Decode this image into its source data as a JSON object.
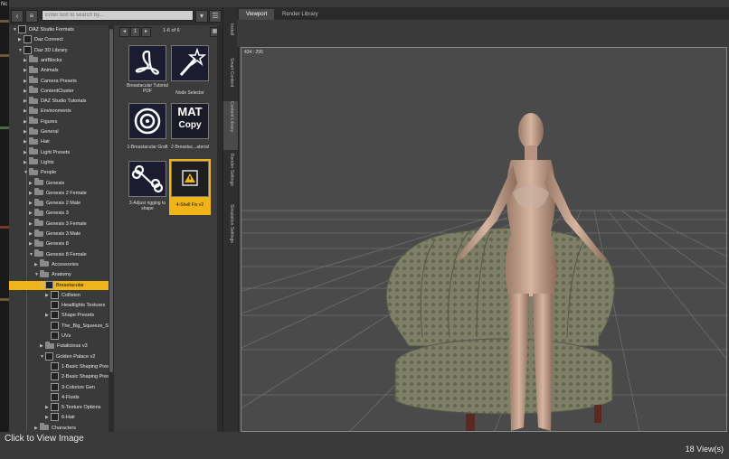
{
  "window": {
    "top_left_text": "Nc"
  },
  "search": {
    "placeholder": "Enter text to search by..."
  },
  "files": {
    "page_label": "1-6 of 6",
    "items": [
      {
        "label": "Breastacular Tutorial PDF",
        "icon": "pdf-icon"
      },
      {
        "label": "Node Selector",
        "icon": "wand-icon"
      },
      {
        "label": "1-Breastacular Graft",
        "icon": "target-icon"
      },
      {
        "label": "2-Breastac...aterial",
        "icon": "mat-copy-icon",
        "badge_top": "MAT",
        "badge_bottom": "Copy"
      },
      {
        "label": "3-Adjust rigging to shape",
        "icon": "bone-icon"
      },
      {
        "label": "4-Shell Fix v2",
        "icon": "warning-icon",
        "selected": true
      }
    ]
  },
  "tree": {
    "items": [
      {
        "label": "DAZ Studio Formats",
        "depth": 0,
        "arrow": "▼",
        "type": "root"
      },
      {
        "label": "Daz Connect",
        "depth": 1,
        "arrow": "▶",
        "type": "root"
      },
      {
        "label": "Daz 3D Library",
        "depth": 1,
        "arrow": "▼",
        "type": "root"
      },
      {
        "label": "aniBlocks",
        "depth": 2,
        "arrow": "▶",
        "type": "folder"
      },
      {
        "label": "Animals",
        "depth": 2,
        "arrow": "▶",
        "type": "folder"
      },
      {
        "label": "Camera Presets",
        "depth": 2,
        "arrow": "▶",
        "type": "folder"
      },
      {
        "label": "ContentCluster",
        "depth": 2,
        "arrow": "▶",
        "type": "folder"
      },
      {
        "label": "DAZ Studio Tutorials",
        "depth": 2,
        "arrow": "▶",
        "type": "folder"
      },
      {
        "label": "Environments",
        "depth": 2,
        "arrow": "▶",
        "type": "folder"
      },
      {
        "label": "Figures",
        "depth": 2,
        "arrow": "▶",
        "type": "folder"
      },
      {
        "label": "General",
        "depth": 2,
        "arrow": "▶",
        "type": "folder"
      },
      {
        "label": "Hair",
        "depth": 2,
        "arrow": "▶",
        "type": "folder"
      },
      {
        "label": "Light Presets",
        "depth": 2,
        "arrow": "▶",
        "type": "folder"
      },
      {
        "label": "Lights",
        "depth": 2,
        "arrow": "▶",
        "type": "folder"
      },
      {
        "label": "People",
        "depth": 2,
        "arrow": "▼",
        "type": "folder"
      },
      {
        "label": "Genesis",
        "depth": 3,
        "arrow": "▶",
        "type": "folder"
      },
      {
        "label": "Genesis 2 Female",
        "depth": 3,
        "arrow": "▶",
        "type": "folder"
      },
      {
        "label": "Genesis 2 Male",
        "depth": 3,
        "arrow": "▶",
        "type": "folder"
      },
      {
        "label": "Genesis 3",
        "depth": 3,
        "arrow": "▶",
        "type": "folder"
      },
      {
        "label": "Genesis 3 Female",
        "depth": 3,
        "arrow": "▶",
        "type": "folder"
      },
      {
        "label": "Genesis 3 Male",
        "depth": 3,
        "arrow": "▶",
        "type": "folder"
      },
      {
        "label": "Genesis 8",
        "depth": 3,
        "arrow": "▶",
        "type": "folder"
      },
      {
        "label": "Genesis 8 Female",
        "depth": 3,
        "arrow": "▼",
        "type": "folder"
      },
      {
        "label": "Accessories",
        "depth": 4,
        "arrow": "▶",
        "type": "folder"
      },
      {
        "label": "Anatomy",
        "depth": 4,
        "arrow": "▼",
        "type": "folder"
      },
      {
        "label": "Breastacular",
        "depth": 5,
        "arrow": "▼",
        "type": "item",
        "selected": true
      },
      {
        "label": "Collision",
        "depth": 6,
        "arrow": "▶",
        "type": "item"
      },
      {
        "label": "Headlights Textures",
        "depth": 6,
        "arrow": "",
        "type": "item"
      },
      {
        "label": "Shape Presets",
        "depth": 6,
        "arrow": "▶",
        "type": "item"
      },
      {
        "label": "The_Big_Squeeze_S...",
        "depth": 6,
        "arrow": "",
        "type": "item"
      },
      {
        "label": "UVs",
        "depth": 6,
        "arrow": "",
        "type": "item"
      },
      {
        "label": "Futalicious v3",
        "depth": 5,
        "arrow": "▶",
        "type": "folder"
      },
      {
        "label": "Golden Palace v2",
        "depth": 5,
        "arrow": "▼",
        "type": "item"
      },
      {
        "label": "1-Basic Shaping Pres...",
        "depth": 6,
        "arrow": "",
        "type": "item"
      },
      {
        "label": "2-Basic Shaping Pres...",
        "depth": 6,
        "arrow": "",
        "type": "item"
      },
      {
        "label": "3-Colorize Gen",
        "depth": 6,
        "arrow": "",
        "type": "item"
      },
      {
        "label": "4-Fluids",
        "depth": 6,
        "arrow": "",
        "type": "item"
      },
      {
        "label": "5-Texture Options",
        "depth": 6,
        "arrow": "▶",
        "type": "item"
      },
      {
        "label": "6-Hair",
        "depth": 6,
        "arrow": "▶",
        "type": "item"
      },
      {
        "label": "Characters",
        "depth": 4,
        "arrow": "▶",
        "type": "folder"
      }
    ]
  },
  "side_tabs": [
    {
      "label": "Install"
    },
    {
      "label": "Smart Content"
    },
    {
      "label": "Content Library",
      "active": true
    },
    {
      "label": "Render Settings"
    },
    {
      "label": "Simulation Settings"
    }
  ],
  "viewport": {
    "tabs": [
      {
        "label": "Viewport",
        "active": true
      },
      {
        "label": "Render Library"
      }
    ],
    "coords": "434 : 295"
  },
  "footer": {
    "click_text": "Click to View Image",
    "views_text": "18 View(s)"
  },
  "colors": {
    "accent": "#f0b418",
    "panel": "#3b3b3b",
    "viewport_bg": "#4a4a4a",
    "grid": "#8a8a8a"
  }
}
